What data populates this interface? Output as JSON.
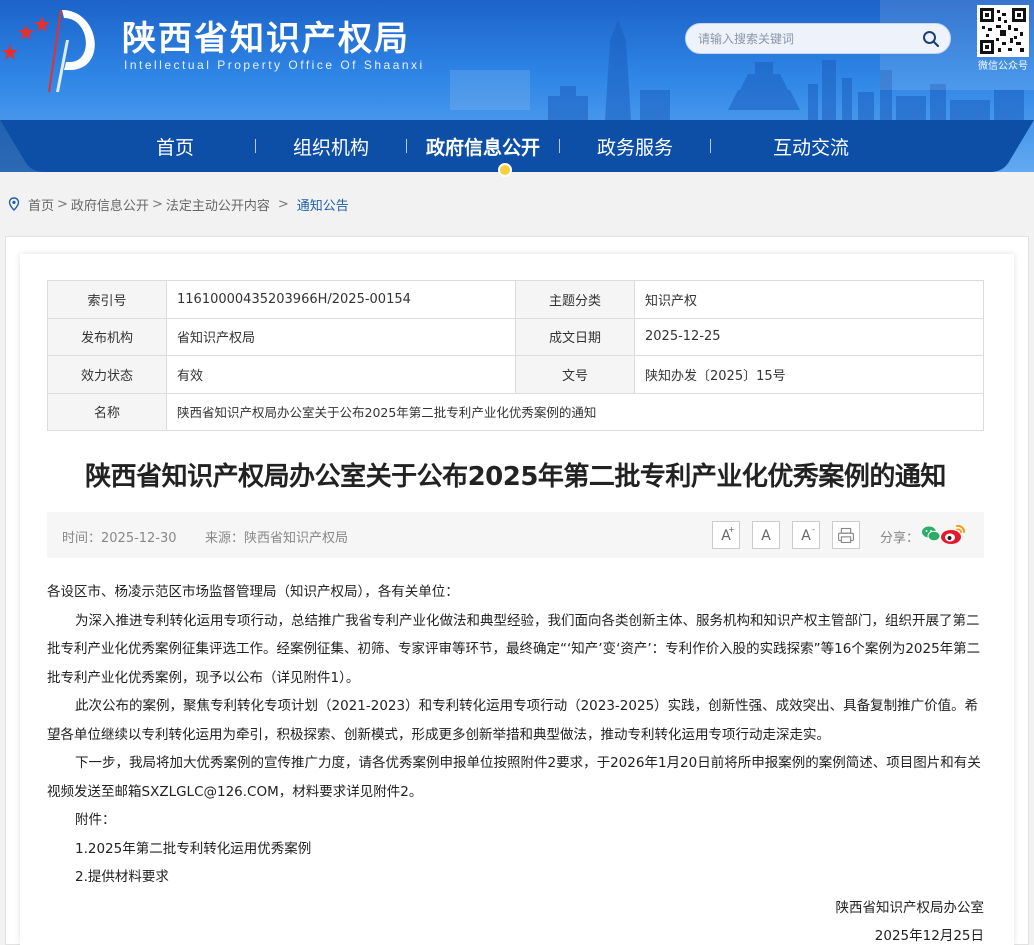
{
  "header": {
    "site_title": "陕西省知识产权局",
    "site_subtitle": "Intellectual Property Office Of Shaanxi",
    "search_placeholder": "请输入搜索关键词",
    "qr_label": "微信公众号"
  },
  "nav": {
    "items": [
      {
        "label": "首页"
      },
      {
        "label": "组织机构"
      },
      {
        "label": "政府信息公开"
      },
      {
        "label": "政务服务"
      },
      {
        "label": "互动交流"
      }
    ],
    "active_index": 2
  },
  "breadcrumb": {
    "items": [
      "首页",
      "政府信息公开",
      "法定主动公开内容",
      "通知公告"
    ]
  },
  "meta": {
    "index_label": "索引号",
    "index_value": "11610000435203966H/2025-00154",
    "topic_label": "主题分类",
    "topic_value": "知识产权",
    "org_label": "发布机构",
    "org_value": "省知识产权局",
    "date_label": "成文日期",
    "date_value": "2025-12-25",
    "status_label": "效力状态",
    "status_value": "有效",
    "docno_label": "文号",
    "docno_value": "陕知办发〔2025〕15号",
    "name_label": "名称",
    "name_value": "陕西省知识产权局办公室关于公布2025年第二批专利产业化优秀案例的通知"
  },
  "article": {
    "title": "陕西省知识产权局办公室关于公布2025年第二批专利产业化优秀案例的通知",
    "time": "时间：2025-12-30",
    "source": "来源：陕西省知识产权局",
    "font_larger": "A",
    "font_normal": "A",
    "font_smaller": "A",
    "share_label": "分享：",
    "salutation": "各设区市、杨凌示范区市场监督管理局（知识产权局），各有关单位：",
    "para1": "为深入推进专利转化运用专项行动，总结推广我省专利产业化做法和典型经验，我们面向各类创新主体、服务机构和知识产权主管部门，组织开展了第二批专利产业化优秀案例征集评选工作。经案例征集、初筛、专家评审等环节，最终确定“‘知产’变‘资产’：专利作价入股的实践探索”等16个案例为2025年第二批专利产业化优秀案例，现予以公布（详见附件1）。",
    "para2": "此次公布的案例，聚焦专利转化专项计划（2021-2023）和专利转化运用专项行动（2023-2025）实践，创新性强、成效突出、具备复制推广价值。希望各单位继续以专利转化运用为牵引，积极探索、创新模式，形成更多创新举措和典型做法，推动专利转化运用专项行动走深走实。",
    "para3": "下一步，我局将加大优秀案例的宣传推广力度，请各优秀案例申报单位按照附件2要求，于2026年1月20日前将所申报案例的案例简述、项目图片和有关视频发送至邮箱SXZLGLC@126.COM，材料要求详见附件2。",
    "attach_label": "附件：",
    "attach1": "1.2025年第二批专利转化运用优秀案例",
    "attach2": "2.提供材料要求",
    "signature": "陕西省知识产权局办公室",
    "sign_date": "2025年12月25日"
  },
  "colors": {
    "header_blue": "#1c63c9",
    "nav_blue": "#0d4ea6",
    "link_blue": "#1f5fa8",
    "accent_red": "#e8302a"
  }
}
